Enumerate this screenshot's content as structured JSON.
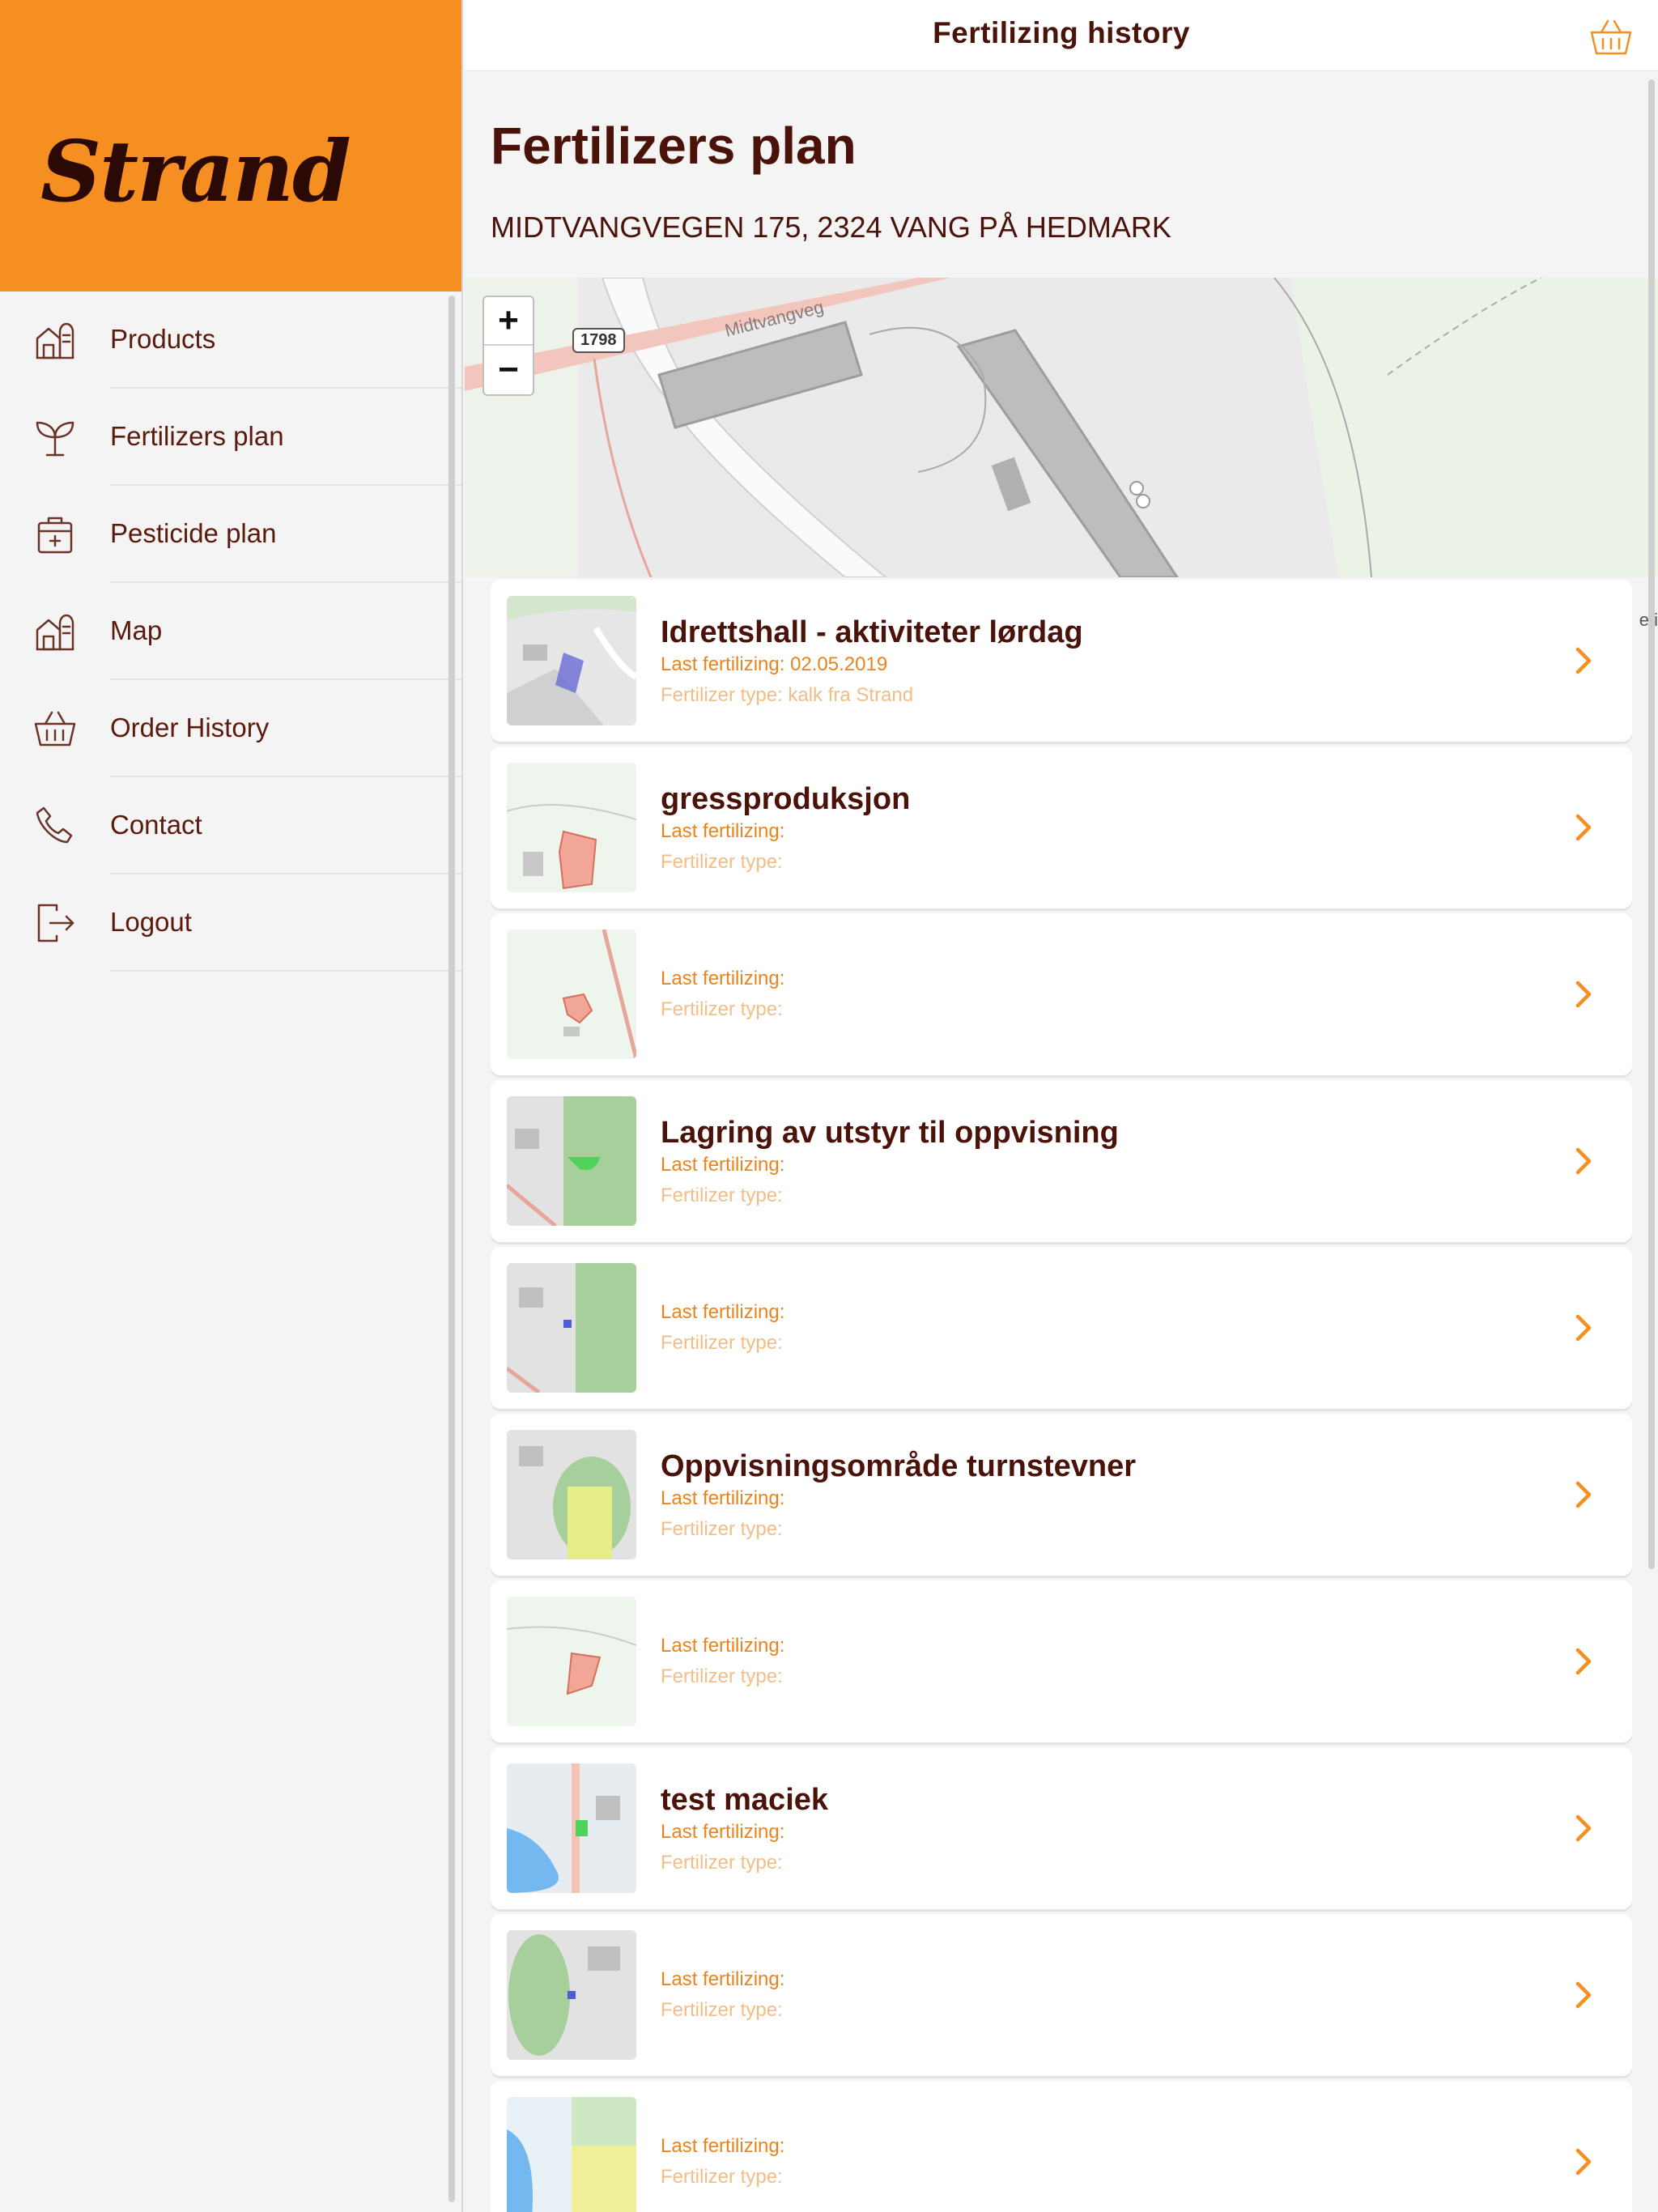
{
  "brand": {
    "logo_text": "Strand"
  },
  "sidebar": {
    "items": [
      {
        "label": "Products",
        "icon": "barn-icon"
      },
      {
        "label": "Fertilizers plan",
        "icon": "sprout-icon"
      },
      {
        "label": "Pesticide plan",
        "icon": "medkit-icon"
      },
      {
        "label": "Map",
        "icon": "barn-map-icon"
      },
      {
        "label": "Order History",
        "icon": "basket-icon"
      },
      {
        "label": "Contact",
        "icon": "phone-icon"
      },
      {
        "label": "Logout",
        "icon": "logout-icon"
      }
    ]
  },
  "header": {
    "title": "Fertilizing history",
    "cart_icon": "basket-icon"
  },
  "page": {
    "title": "Fertilizers plan",
    "address": "MIDTVANGVEGEN 175, 2324 VANG PÅ HEDMARK"
  },
  "map": {
    "zoom_in": "+",
    "zoom_out": "−",
    "road_badge": "1798",
    "road_name": "Midtvangveg",
    "edge_text": "eti"
  },
  "fields": [
    {
      "name": "Idrettshall - aktiviteter lørdag",
      "last": "Last fertilizing: 02.05.2019",
      "type": "Fertilizer type: kalk fra Strand",
      "thumb": "gray-blue"
    },
    {
      "name": "gressproduksjon",
      "last": "Last fertilizing:",
      "type": "Fertilizer type:",
      "thumb": "green-red"
    },
    {
      "name": "",
      "last": "Last fertilizing:",
      "type": "Fertilizer type:",
      "thumb": "green-red-small"
    },
    {
      "name": "Lagring av utstyr til oppvisning",
      "last": "Last fertilizing:",
      "type": "Fertilizer type:",
      "thumb": "field-green"
    },
    {
      "name": "",
      "last": "Last fertilizing:",
      "type": "Fertilizer type:",
      "thumb": "field-green-2"
    },
    {
      "name": "Oppvisningsområde turnstevner",
      "last": "Last fertilizing:",
      "type": "Fertilizer type:",
      "thumb": "track"
    },
    {
      "name": "",
      "last": "Last fertilizing:",
      "type": "Fertilizer type:",
      "thumb": "green-red-2"
    },
    {
      "name": "test maciek",
      "last": "Last fertilizing:",
      "type": "Fertilizer type:",
      "thumb": "water"
    },
    {
      "name": "",
      "last": "Last fertilizing:",
      "type": "Fertilizer type:",
      "thumb": "track-2"
    },
    {
      "name": "",
      "last": "Last fertilizing:",
      "type": "Fertilizer type:",
      "thumb": "yellow"
    }
  ],
  "colors": {
    "brand": "#f58f22",
    "text": "#4a1209",
    "accent": "#e8841e",
    "muted": "#f2bd87"
  }
}
